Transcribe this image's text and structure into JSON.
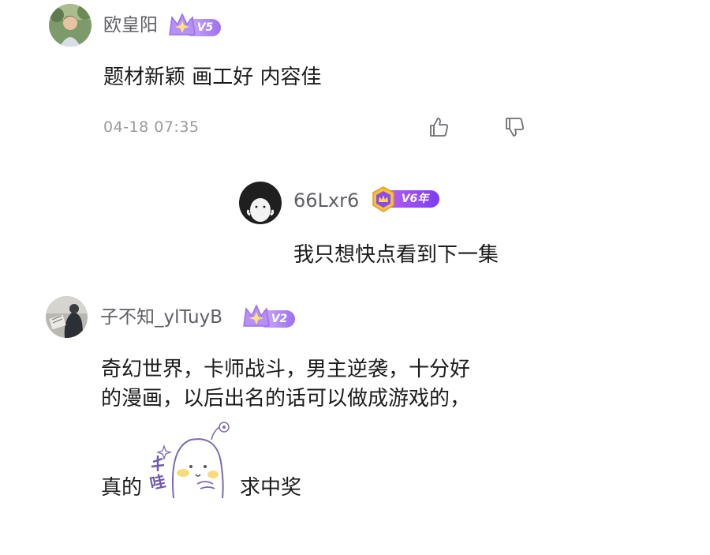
{
  "comments": [
    {
      "username": "欧皇阳",
      "vip_level": "V5",
      "text": "题材新颖 画工好 内容佳",
      "timestamp": "04-18 07:35",
      "actions": {
        "like_icon": "thumbs-up-icon",
        "dislike_icon": "thumbs-down-icon"
      }
    },
    {
      "username": "66Lxr6",
      "vip_level": "V6年",
      "text": "我只想快点看到下一集",
      "reply": true
    },
    {
      "username": "子不知_ylTuyB",
      "vip_level": "V2",
      "text_line1": "奇幻世界，卡师战斗，男主逆袭，十分好",
      "text_line2": "的漫画，以后出名的话可以做成游戏的，",
      "text_before_sticker": "真的",
      "sticker_icon": "wow-ghost-sticker",
      "sticker_text": "哇",
      "text_after_sticker": "求中奖"
    }
  ],
  "colors": {
    "username": "#5f5f66",
    "text": "#1b1b1b",
    "timestamp": "#9a9a9f",
    "vip_purple": "#a87cf0",
    "vip_v6_gold": "#f2b233",
    "vip_v6_purple": "#8b4bf3"
  }
}
